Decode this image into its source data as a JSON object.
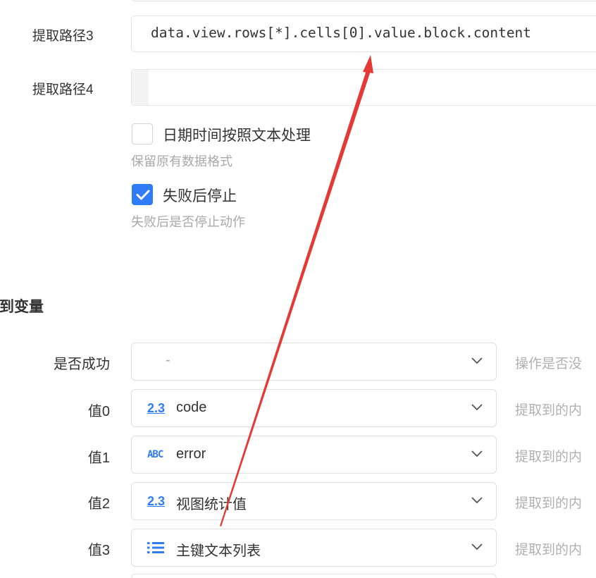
{
  "extraction": {
    "path3": {
      "label": "提取路径3",
      "value": "data.view.rows[*].cells[0].value.block.content"
    },
    "path4": {
      "label": "提取路径4",
      "value": ""
    }
  },
  "options": {
    "datetime_as_text": {
      "label": "日期时间按照文本处理",
      "hint": "保留原有数据格式",
      "checked": false
    },
    "stop_on_failure": {
      "label": "失败后停止",
      "hint": "失败后是否停止动作",
      "checked": true
    }
  },
  "output": {
    "section_title": "出到变量",
    "rows": [
      {
        "label": "是否成功",
        "icon": "",
        "value": "-",
        "desc": "操作是否没"
      },
      {
        "label": "值0",
        "icon": "number-type-icon",
        "icon_text": "2.3",
        "value": "code",
        "desc": "提取到的内"
      },
      {
        "label": "值1",
        "icon": "text-type-icon",
        "icon_text": "ABC",
        "value": "error",
        "desc": "提取到的内"
      },
      {
        "label": "值2",
        "icon": "number-type-icon",
        "icon_text": "2.3",
        "value": "视图统计值",
        "desc": "提取到的内"
      },
      {
        "label": "值3",
        "icon": "list-type-icon",
        "icon_text": "",
        "value": "主键文本列表",
        "desc": "提取到的内"
      }
    ]
  },
  "colors": {
    "accent": "#2f7cf6",
    "annotation_arrow": "#e53935"
  }
}
